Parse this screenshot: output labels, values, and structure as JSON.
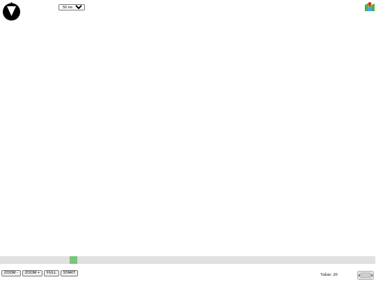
{
  "compass": {
    "icon": "compass-icon"
  },
  "distance_select": {
    "selected": "50 meters",
    "options": [
      "50 meters"
    ]
  },
  "map_icon": {
    "icon": "map-pin-icon"
  },
  "timeline": {
    "position_fraction": 0.2,
    "track_color": "#e0e0e0",
    "thumb_color": "#7cc47d"
  },
  "controls": {
    "zoom_out_label": "ZOOM -",
    "zoom_in_label": "ZOOM +",
    "full_label": "FULL",
    "start_label": "START"
  },
  "value_readout": "Value: 20",
  "play_button": {
    "icon": "play-pause-icon"
  }
}
